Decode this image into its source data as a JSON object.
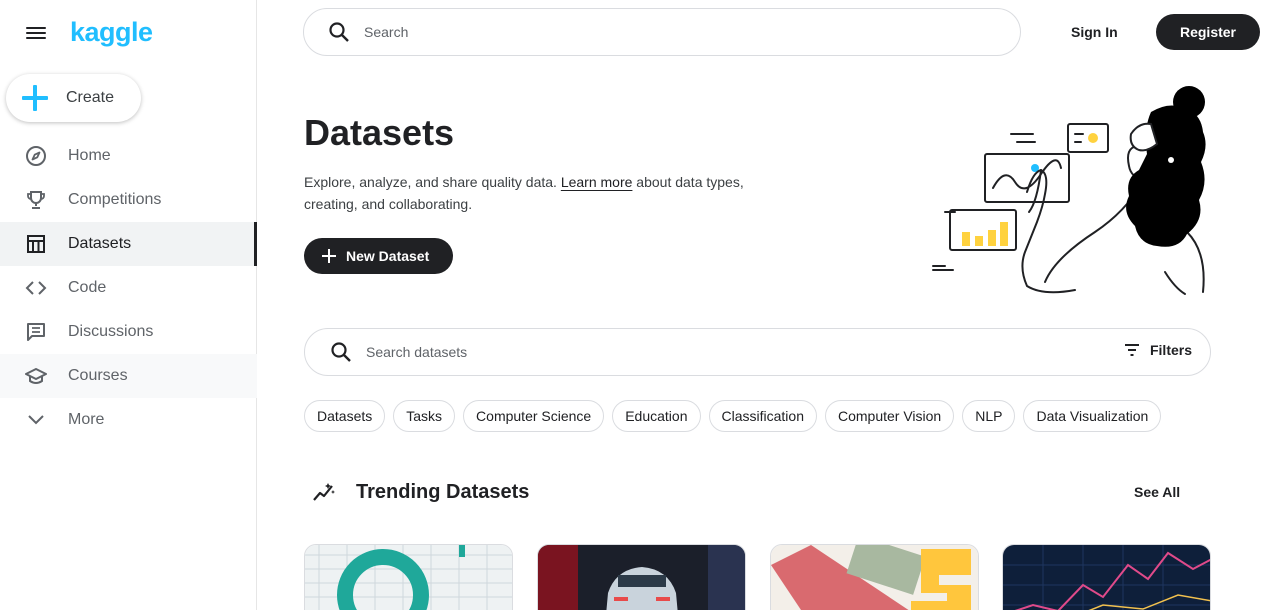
{
  "app": {
    "logo": "kaggle"
  },
  "sidebar": {
    "create_label": "Create",
    "items": [
      {
        "label": "Home",
        "icon": "compass-icon"
      },
      {
        "label": "Competitions",
        "icon": "trophy-icon"
      },
      {
        "label": "Datasets",
        "icon": "table-icon",
        "active": true
      },
      {
        "label": "Code",
        "icon": "code-icon"
      },
      {
        "label": "Discussions",
        "icon": "comments-icon"
      },
      {
        "label": "Courses",
        "icon": "school-icon"
      },
      {
        "label": "More",
        "icon": "chevron-down-icon"
      }
    ]
  },
  "header": {
    "search_placeholder": "Search",
    "sign_in": "Sign In",
    "register": "Register"
  },
  "hero": {
    "title": "Datasets",
    "description_before": "Explore, analyze, and share quality data. ",
    "learn_more": "Learn more",
    "description_after": " about data types, creating, and collaborating.",
    "new_dataset": "New Dataset"
  },
  "dataset_search": {
    "placeholder": "Search datasets",
    "filters_label": "Filters"
  },
  "chips": [
    "Datasets",
    "Tasks",
    "Computer Science",
    "Education",
    "Classification",
    "Computer Vision",
    "NLP",
    "Data Visualization"
  ],
  "trending": {
    "title": "Trending Datasets",
    "see_all": "See All"
  },
  "colors": {
    "brand": "#20beff",
    "primary_dark": "#202124",
    "border": "#dadce0",
    "accent_yellow": "#ffd23f"
  }
}
